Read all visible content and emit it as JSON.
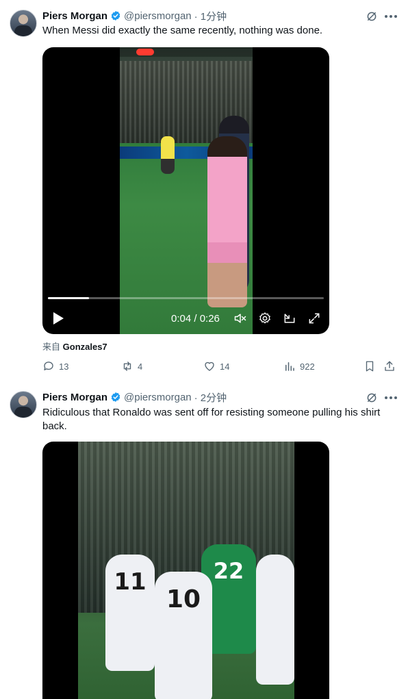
{
  "tweets": [
    {
      "author": "Piers Morgan",
      "handle": "@piersmorgan",
      "time": "· 1分钟",
      "text": "When Messi did exactly the same recently, nothing was done.",
      "video": {
        "time": "0:04 / 0:26",
        "progress_percent": 15
      },
      "source_prefix": "来自",
      "source_name": "Gonzales7",
      "stats": {
        "replies": "13",
        "reposts": "4",
        "likes": "14",
        "views": "922"
      }
    },
    {
      "author": "Piers Morgan",
      "handle": "@piersmorgan",
      "time": "· 2分钟",
      "text": "Ridiculous that Ronaldo was sent off for resisting someone pulling his shirt back."
    }
  ],
  "video2_overlay": {
    "jersey_left": "11",
    "jersey_center": "10",
    "jersey_green": "22"
  },
  "colors": {
    "verified": "#1d9bf0",
    "secondary": "#536471",
    "primary_text": "#0f1419"
  },
  "icons": [
    "verified-icon",
    "grok-icon",
    "more-icon",
    "play-icon",
    "volume-icon",
    "settings-icon",
    "pip-icon",
    "fullscreen-icon",
    "reply-icon",
    "repost-icon",
    "like-icon",
    "views-icon",
    "bookmark-icon",
    "share-icon"
  ]
}
